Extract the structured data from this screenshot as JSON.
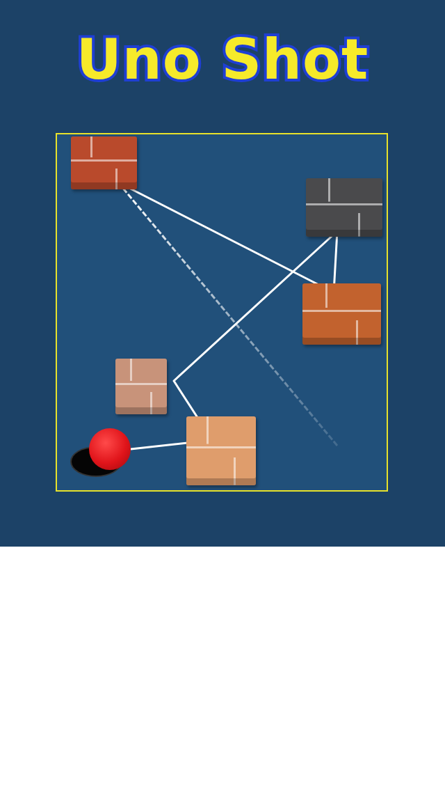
{
  "title": "Uno Shot",
  "bricks": [
    {
      "color": "#b94a2c"
    },
    {
      "color": "#4a4a4c"
    },
    {
      "color": "#c2622e"
    },
    {
      "color": "#c8937a"
    },
    {
      "color": "#df9d6c"
    }
  ]
}
